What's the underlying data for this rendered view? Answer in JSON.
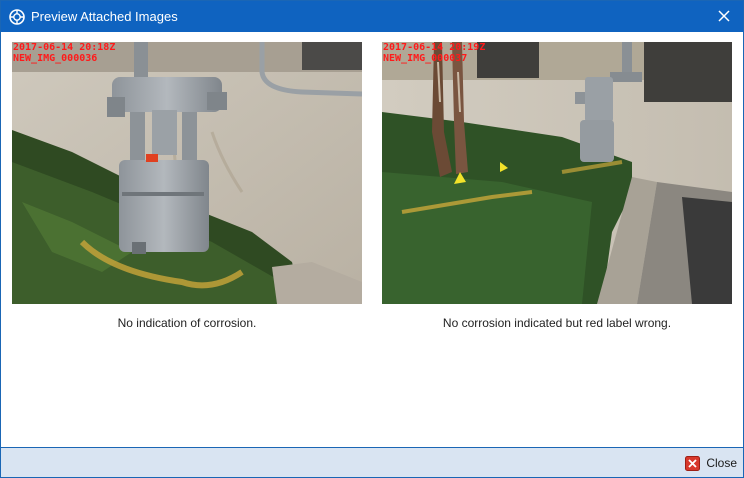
{
  "window": {
    "title": "Preview Attached Images",
    "footer_close_label": "Close"
  },
  "images": [
    {
      "timestamp": "2017-06-14 20:18Z",
      "image_id": "NEW_IMG_000036",
      "caption": "No indication of corrosion."
    },
    {
      "timestamp": "2017-06-14 20:19Z",
      "image_id": "NEW_IMG_000037",
      "caption": "No corrosion indicated but red label wrong."
    }
  ],
  "colors": {
    "titlebar": "#0f63c0",
    "footer": "#d9e4f2",
    "stamp_text": "#ff1a1a"
  }
}
